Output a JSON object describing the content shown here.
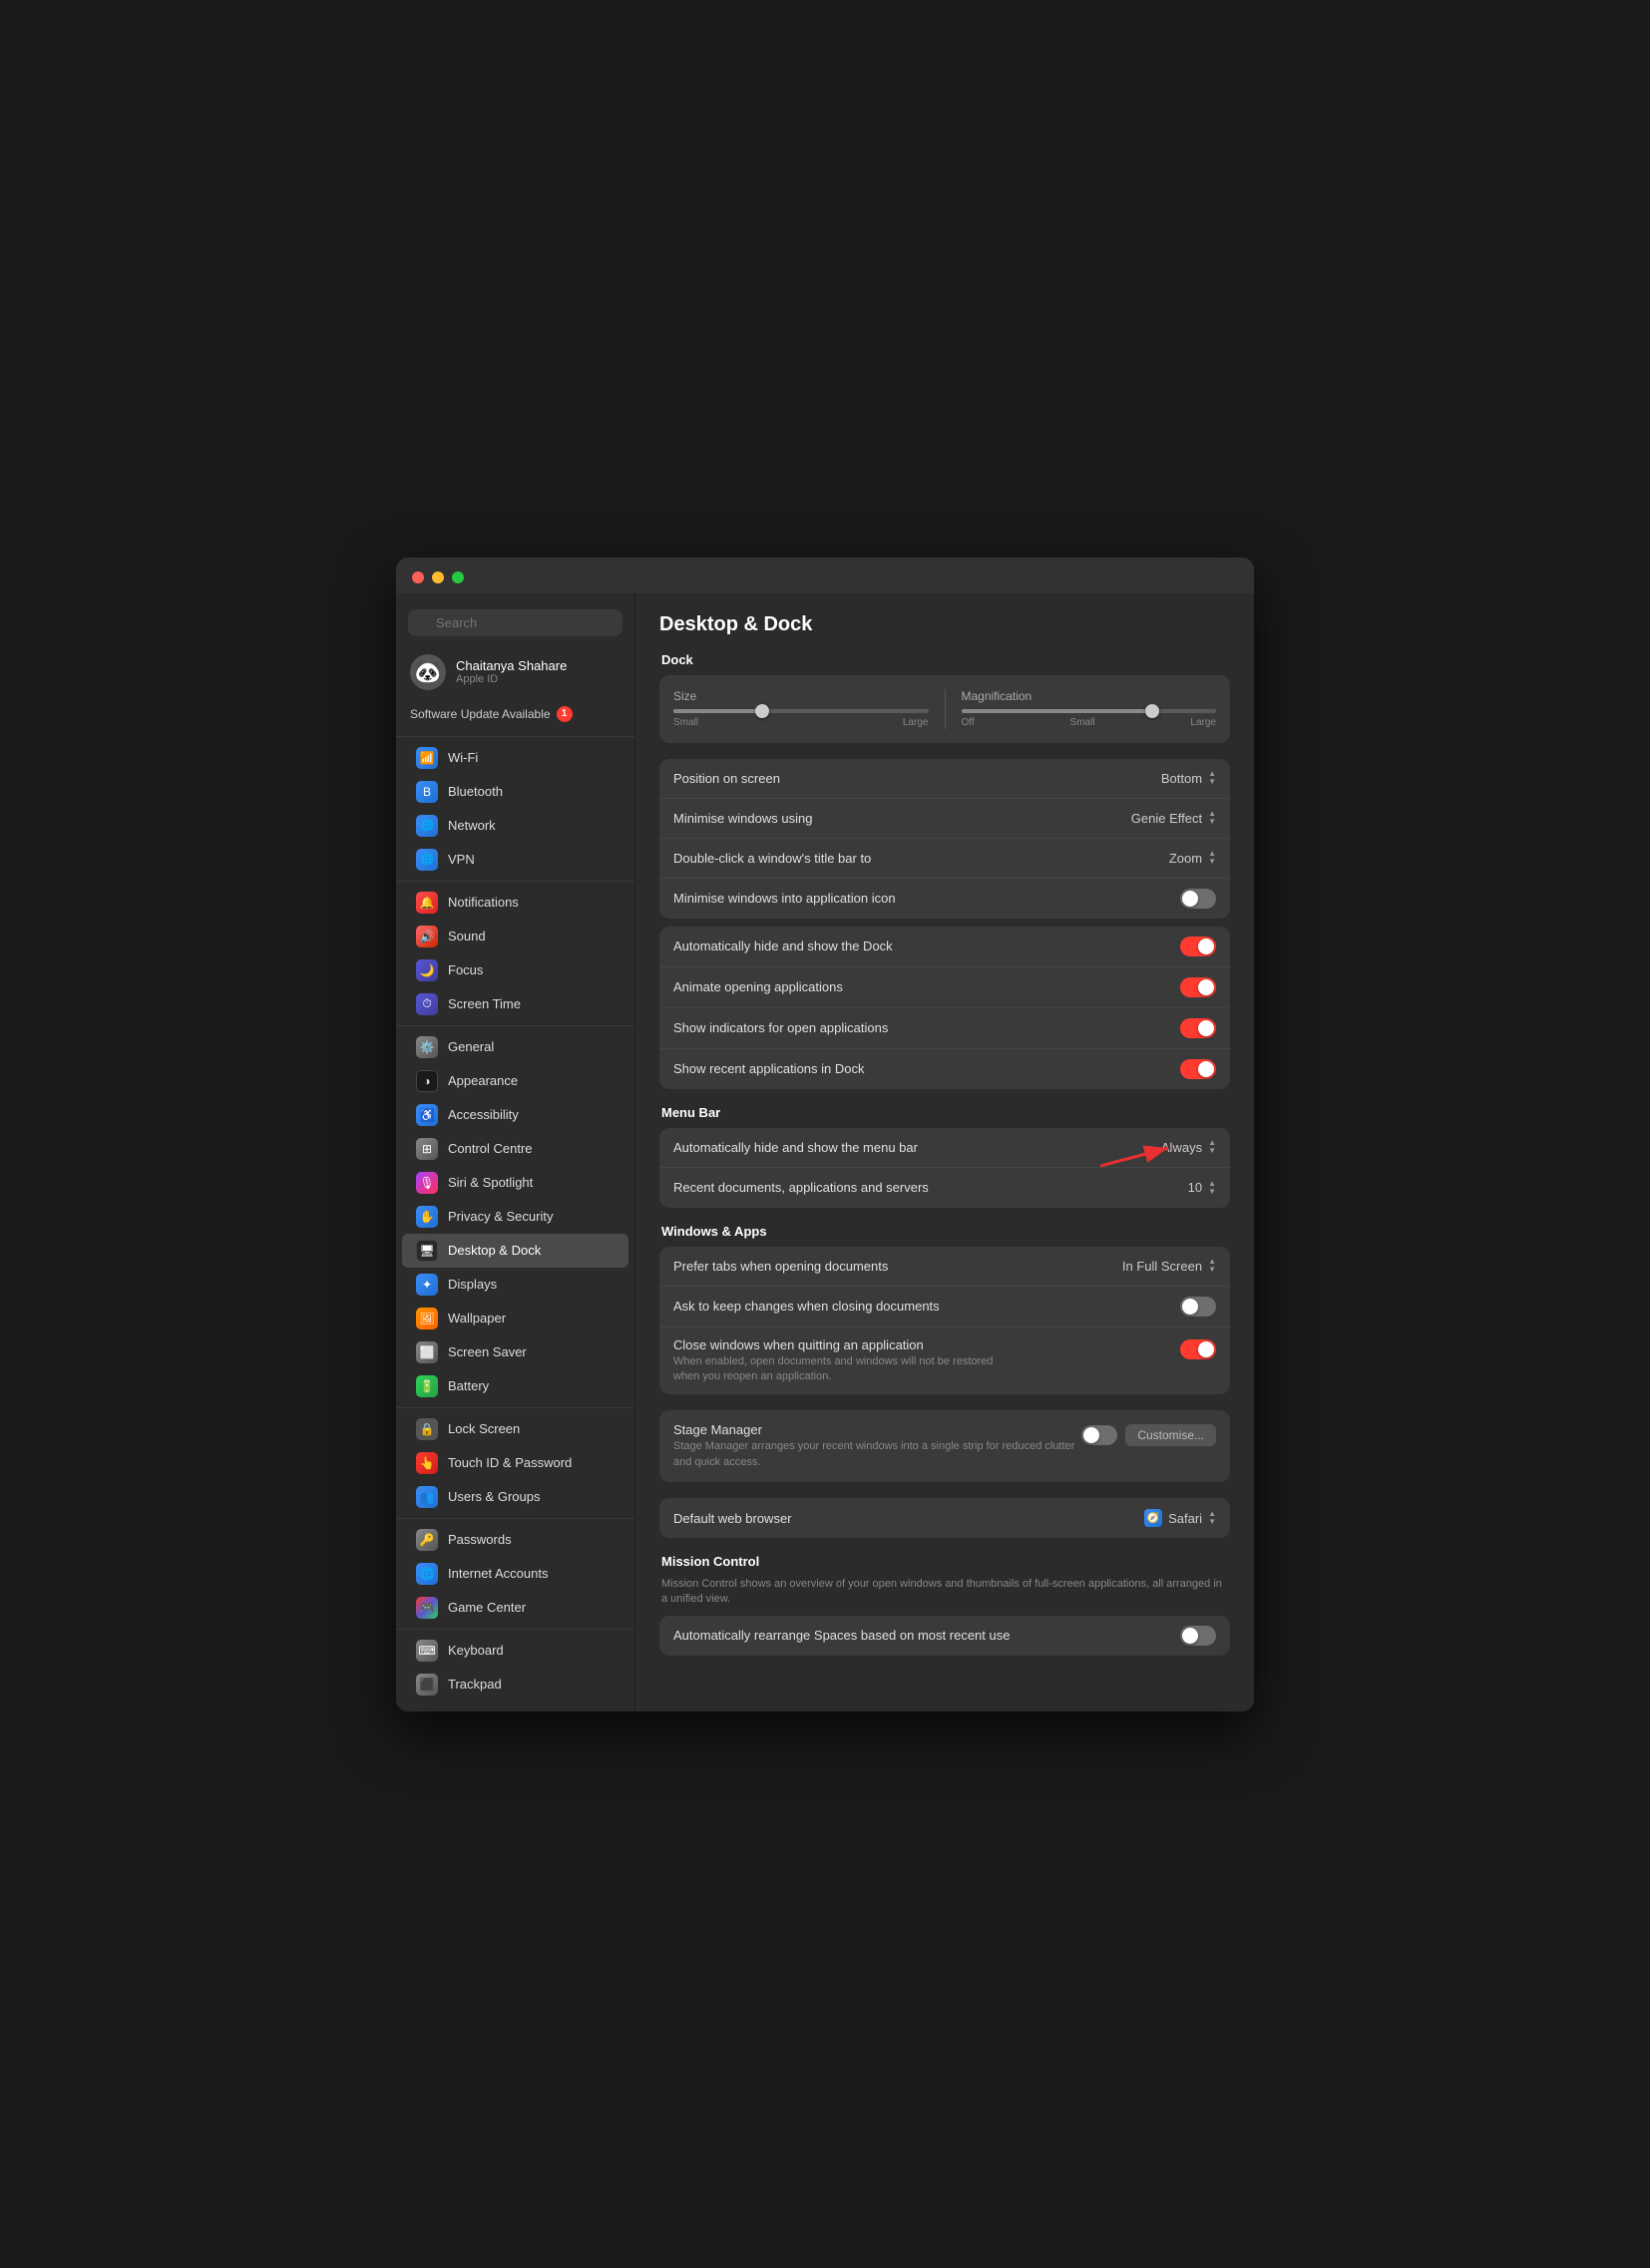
{
  "window": {
    "title": "Desktop & Dock"
  },
  "sidebar": {
    "search": {
      "placeholder": "Search",
      "value": ""
    },
    "user": {
      "name": "Chaitanya Shahare",
      "subtitle": "Apple ID",
      "avatar_emoji": "🐼"
    },
    "software_update": {
      "label": "Software Update Available",
      "badge": "1"
    },
    "items": [
      {
        "id": "wifi",
        "label": "Wi-Fi",
        "icon_class": "icon-wifi",
        "icon": "📶",
        "group": "network"
      },
      {
        "id": "bluetooth",
        "label": "Bluetooth",
        "icon_class": "icon-bluetooth",
        "icon": "🔷",
        "group": "network"
      },
      {
        "id": "network",
        "label": "Network",
        "icon_class": "icon-network",
        "icon": "🌐",
        "group": "network"
      },
      {
        "id": "vpn",
        "label": "VPN",
        "icon_class": "icon-vpn",
        "icon": "🌐",
        "group": "network"
      },
      {
        "id": "notifications",
        "label": "Notifications",
        "icon_class": "icon-notifications",
        "icon": "🔔",
        "group": "system"
      },
      {
        "id": "sound",
        "label": "Sound",
        "icon_class": "icon-sound",
        "icon": "🔊",
        "group": "system"
      },
      {
        "id": "focus",
        "label": "Focus",
        "icon_class": "icon-focus",
        "icon": "🌙",
        "group": "system"
      },
      {
        "id": "screentime",
        "label": "Screen Time",
        "icon_class": "icon-screentime",
        "icon": "⏱",
        "group": "system"
      },
      {
        "id": "general",
        "label": "General",
        "icon_class": "icon-general",
        "icon": "⚙️",
        "group": "prefs"
      },
      {
        "id": "appearance",
        "label": "Appearance",
        "icon_class": "icon-appearance",
        "icon": "◑",
        "group": "prefs"
      },
      {
        "id": "accessibility",
        "label": "Accessibility",
        "icon_class": "icon-accessibility",
        "icon": "ℹ",
        "group": "prefs"
      },
      {
        "id": "controlcentre",
        "label": "Control Centre",
        "icon_class": "icon-controlcentre",
        "icon": "⊞",
        "group": "prefs"
      },
      {
        "id": "siri",
        "label": "Siri & Spotlight",
        "icon_class": "icon-siri",
        "icon": "🎙",
        "group": "prefs"
      },
      {
        "id": "privacy",
        "label": "Privacy & Security",
        "icon_class": "icon-privacy",
        "icon": "✋",
        "group": "prefs"
      },
      {
        "id": "desktop",
        "label": "Desktop & Dock",
        "icon_class": "icon-desktop",
        "icon": "🖥",
        "group": "prefs",
        "active": true
      },
      {
        "id": "displays",
        "label": "Displays",
        "icon_class": "icon-displays",
        "icon": "✦",
        "group": "prefs"
      },
      {
        "id": "wallpaper",
        "label": "Wallpaper",
        "icon_class": "icon-wallpaper",
        "icon": "🖼",
        "group": "prefs"
      },
      {
        "id": "screensaver",
        "label": "Screen Saver",
        "icon_class": "icon-screensaver",
        "icon": "⬜",
        "group": "prefs"
      },
      {
        "id": "battery",
        "label": "Battery",
        "icon_class": "icon-battery",
        "icon": "🔋",
        "group": "prefs"
      },
      {
        "id": "lockscreen",
        "label": "Lock Screen",
        "icon_class": "icon-lockscreen",
        "icon": "🔒",
        "group": "prefs"
      },
      {
        "id": "touchid",
        "label": "Touch ID & Password",
        "icon_class": "icon-touchid",
        "icon": "👆",
        "group": "prefs"
      },
      {
        "id": "users",
        "label": "Users & Groups",
        "icon_class": "icon-users",
        "icon": "👥",
        "group": "prefs"
      },
      {
        "id": "passwords",
        "label": "Passwords",
        "icon_class": "icon-passwords",
        "icon": "🔑",
        "group": "prefs"
      },
      {
        "id": "internet",
        "label": "Internet Accounts",
        "icon_class": "icon-internet",
        "icon": "🌐",
        "group": "prefs"
      },
      {
        "id": "gamecenter",
        "label": "Game Center",
        "icon_class": "icon-gamecenter",
        "icon": "🎮",
        "group": "prefs"
      },
      {
        "id": "keyboard",
        "label": "Keyboard",
        "icon_class": "icon-keyboard",
        "icon": "⌨",
        "group": "input"
      },
      {
        "id": "trackpad",
        "label": "Trackpad",
        "icon_class": "icon-trackpad",
        "icon": "⬛",
        "group": "input"
      }
    ]
  },
  "main": {
    "title": "Desktop & Dock",
    "dock_section": {
      "title": "Dock",
      "size_label": "Size",
      "size_small": "Small",
      "size_large": "Large",
      "magnification_label": "Magnification",
      "magnification_off": "Off",
      "magnification_small": "Small",
      "magnification_large": "Large",
      "size_value": 35,
      "magnification_value": 75,
      "rows": [
        {
          "label": "Position on screen",
          "value": "Bottom",
          "type": "stepper"
        },
        {
          "label": "Minimise windows using",
          "value": "Genie Effect",
          "type": "stepper"
        },
        {
          "label": "Double-click a window's title bar to",
          "value": "Zoom",
          "type": "stepper"
        },
        {
          "label": "Minimise windows into application icon",
          "value": "",
          "type": "toggle",
          "toggle_state": "off"
        }
      ],
      "toggles": [
        {
          "label": "Automatically hide and show the Dock",
          "state": "on"
        },
        {
          "label": "Animate opening applications",
          "state": "on"
        },
        {
          "label": "Show indicators for open applications",
          "state": "on"
        },
        {
          "label": "Show recent applications in Dock",
          "state": "on"
        }
      ]
    },
    "menubar_section": {
      "title": "Menu Bar",
      "rows": [
        {
          "label": "Automatically hide and show the menu bar",
          "value": "Always",
          "type": "stepper"
        },
        {
          "label": "Recent documents, applications and servers",
          "value": "10",
          "type": "stepper"
        }
      ]
    },
    "windows_section": {
      "title": "Windows & Apps",
      "rows": [
        {
          "label": "Prefer tabs when opening documents",
          "value": "In Full Screen",
          "type": "stepper"
        },
        {
          "label": "Ask to keep changes when closing documents",
          "value": "",
          "type": "toggle",
          "toggle_state": "off"
        },
        {
          "label": "Close windows when quitting an application",
          "value": "",
          "type": "toggle",
          "toggle_state": "on",
          "sublabel": "When enabled, open documents and windows will not be restored when you reopen an application."
        }
      ]
    },
    "stage_manager": {
      "title": "Stage Manager",
      "subtitle": "Stage Manager arranges your recent windows into a single strip for reduced clutter and quick access.",
      "toggle_state": "off",
      "customise_label": "Customise..."
    },
    "default_browser": {
      "label": "Default web browser",
      "value": "Safari"
    },
    "mission_control": {
      "title": "Mission Control",
      "subtitle": "Mission Control shows an overview of your open windows and thumbnails of full-screen applications, all arranged in a unified view.",
      "rows": [
        {
          "label": "Automatically rearrange Spaces based on most recent use",
          "type": "toggle",
          "toggle_state": "off"
        }
      ]
    }
  }
}
